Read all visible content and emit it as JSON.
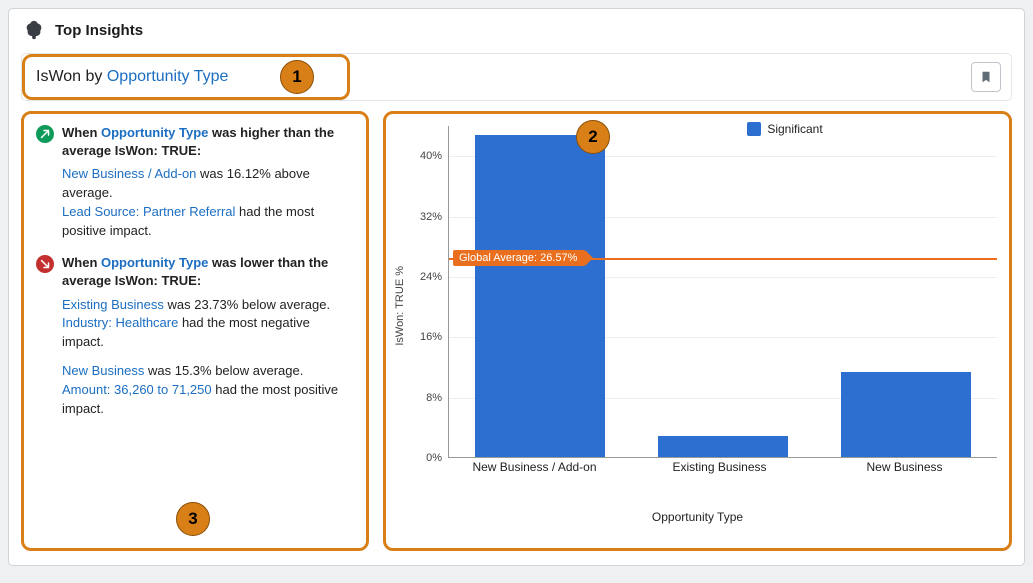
{
  "header": {
    "title": "Top Insights"
  },
  "titleRow": {
    "prefix": "IsWon by ",
    "dimension": "Opportunity Type"
  },
  "callouts": {
    "one": "1",
    "two": "2",
    "three": "3"
  },
  "insights": {
    "higher": {
      "lead": "When ",
      "linkDim": "Opportunity Type",
      "tail": " was higher than the average IsWon: TRUE:",
      "p1_link": "New Business / Add-on",
      "p1_rest": " was 16.12% above average.",
      "p2_link": "Lead Source: Partner Referral",
      "p2_rest": " had the most positive impact."
    },
    "lower": {
      "lead": "When ",
      "linkDim": "Opportunity Type",
      "tail": " was lower than the average IsWon: TRUE:",
      "p1_link": "Existing Business",
      "p1_rest": " was 23.73% below average.",
      "p2_link": "Industry: Healthcare",
      "p2_rest": " had the most negative impact.",
      "p3_link": "New Business",
      "p3_rest": " was 15.3% below average.",
      "p4_link": "Amount: 36,260 to 71,250",
      "p4_rest": " had the most positive impact."
    }
  },
  "legend": {
    "label": "Significant"
  },
  "axes": {
    "ylabel": "IsWon: TRUE %",
    "xlabel": "Opportunity Type",
    "yticks": [
      "0%",
      "8%",
      "16%",
      "24%",
      "32%",
      "40%"
    ]
  },
  "avg": {
    "label": "Global Average: 26.57%"
  },
  "chart_data": {
    "type": "bar",
    "title": "IsWon by Opportunity Type",
    "xlabel": "Opportunity Type",
    "ylabel": "IsWon: TRUE %",
    "ylim": [
      0,
      44
    ],
    "categories": [
      "New Business / Add-on",
      "Existing Business",
      "New Business"
    ],
    "values": [
      42.69,
      2.84,
      11.27
    ],
    "global_average": 26.57,
    "legend": [
      "Significant"
    ],
    "colors": {
      "bar": "#2d6fd0",
      "avg_line": "#e96f1e"
    }
  }
}
